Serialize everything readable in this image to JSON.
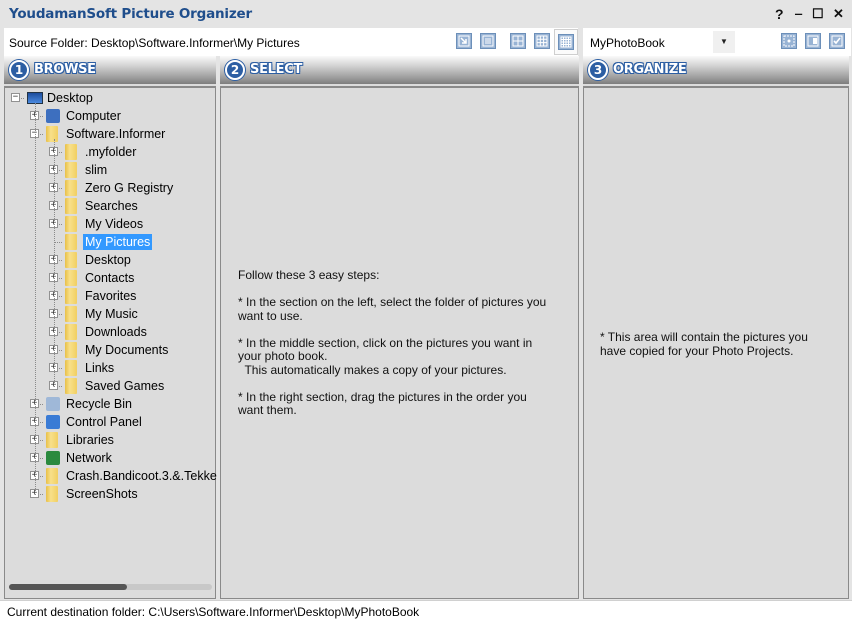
{
  "window": {
    "title": "YoudamanSoft Picture Organizer",
    "help_label": "?",
    "minimize_label": "‒",
    "maximize_label": "☐",
    "close_label": "✕"
  },
  "toolbar": {
    "source_folder_text": "Source Folder: Desktop\\Software.Informer\\My Pictures",
    "view_buttons": [
      {
        "name": "import-icon",
        "tooltip": ""
      },
      {
        "name": "list-view-icon",
        "tooltip": ""
      },
      {
        "name": "grid-2x2-icon",
        "tooltip": ""
      },
      {
        "name": "grid-3x3-icon",
        "tooltip": ""
      },
      {
        "name": "grid-4x4-icon",
        "tooltip": ""
      }
    ],
    "project_combo_value": "MyPhotoBook",
    "organize_buttons": [
      "select-area-icon",
      "copy-icon",
      "check-icon"
    ]
  },
  "panels": {
    "browse": {
      "number": "1",
      "title": "BROWSE"
    },
    "select": {
      "number": "2",
      "title": "SELECT",
      "instructions": "Follow these 3 easy steps:\n\n* In the section on the left, select the folder of pictures you\nwant to use.\n\n* In the middle section, click on the pictures you want in\nyour photo book.\n  This automatically makes a copy of your pictures.\n\n* In the right section, drag the pictures in the order you\nwant them."
    },
    "organize": {
      "number": "3",
      "title": "ORGANIZE",
      "placeholder": "* This area will contain the pictures you\nhave copied for your Photo Projects."
    }
  },
  "tree": [
    {
      "label": "Desktop",
      "level": 0,
      "expander": "−",
      "icon": "desktop-icon"
    },
    {
      "label": "Computer",
      "level": 1,
      "expander": "+",
      "icon": "computer-icon"
    },
    {
      "label": "Software.Informer",
      "level": 1,
      "expander": "−",
      "icon": "user-folder-icon"
    },
    {
      "label": ".myfolder",
      "level": 2,
      "expander": "+",
      "icon": "folder-icon"
    },
    {
      "label": "slim",
      "level": 2,
      "expander": "+",
      "icon": "folder-icon"
    },
    {
      "label": "Zero G Registry",
      "level": 2,
      "expander": "+",
      "icon": "folder-icon"
    },
    {
      "label": "Searches",
      "level": 2,
      "expander": "+",
      "icon": "search-folder-icon"
    },
    {
      "label": "My Videos",
      "level": 2,
      "expander": "+",
      "icon": "videos-folder-icon"
    },
    {
      "label": "My Pictures",
      "level": 2,
      "expander": "",
      "icon": "pictures-folder-icon",
      "selected": true
    },
    {
      "label": "Desktop",
      "level": 2,
      "expander": "+",
      "icon": "desktop-folder-icon"
    },
    {
      "label": "Contacts",
      "level": 2,
      "expander": "+",
      "icon": "contacts-folder-icon"
    },
    {
      "label": "Favorites",
      "level": 2,
      "expander": "+",
      "icon": "favorites-folder-icon"
    },
    {
      "label": "My Music",
      "level": 2,
      "expander": "+",
      "icon": "music-folder-icon"
    },
    {
      "label": "Downloads",
      "level": 2,
      "expander": "+",
      "icon": "downloads-folder-icon"
    },
    {
      "label": "My Documents",
      "level": 2,
      "expander": "+",
      "icon": "documents-folder-icon"
    },
    {
      "label": "Links",
      "level": 2,
      "expander": "+",
      "icon": "links-folder-icon"
    },
    {
      "label": "Saved Games",
      "level": 2,
      "expander": "+",
      "icon": "games-folder-icon"
    },
    {
      "label": "Recycle Bin",
      "level": 1,
      "expander": "+",
      "icon": "recycle-bin-icon"
    },
    {
      "label": "Control Panel",
      "level": 1,
      "expander": "+",
      "icon": "control-panel-icon"
    },
    {
      "label": "Libraries",
      "level": 1,
      "expander": "+",
      "icon": "libraries-icon"
    },
    {
      "label": "Network",
      "level": 1,
      "expander": "+",
      "icon": "network-icon"
    },
    {
      "label": "Crash.Bandicoot.3.&.Tekke",
      "level": 1,
      "expander": "+",
      "icon": "folder-icon"
    },
    {
      "label": "ScreenShots",
      "level": 1,
      "expander": "+",
      "icon": "folder-icon"
    }
  ],
  "browse_scroll": {
    "thumb_fraction": 0.58,
    "position": 0
  },
  "status": {
    "text": "Current destination folder: C:\\Users\\Software.Informer\\Desktop\\MyPhotoBook"
  },
  "colors": {
    "title": "#1f4e8c",
    "accent": "#2c5ea3",
    "selection": "#3399ff",
    "panel_bg": "#dcdcdc"
  }
}
